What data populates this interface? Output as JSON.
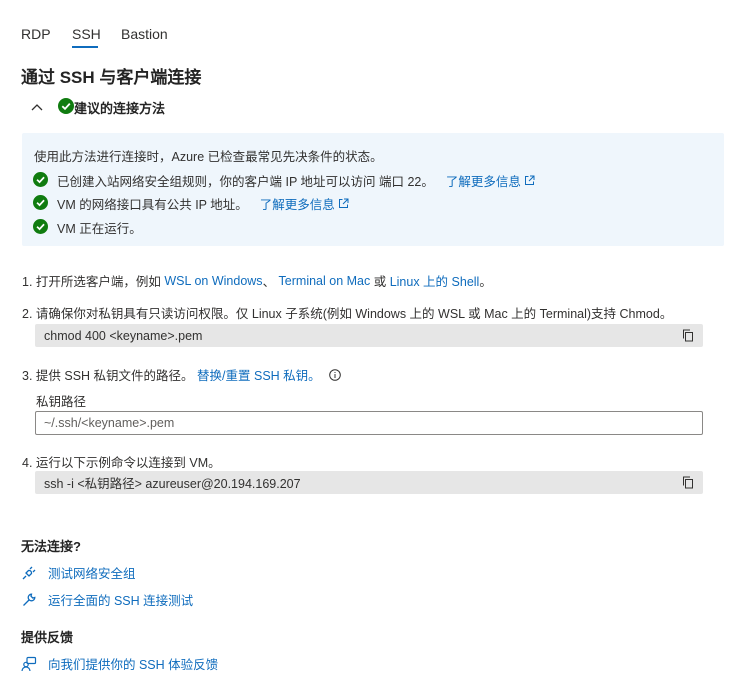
{
  "tabs": [
    {
      "label": "RDP"
    },
    {
      "label": "SSH"
    },
    {
      "label": "Bastion"
    }
  ],
  "page_title": "通过 SSH 与客户端连接",
  "expander": {
    "label": "建议的连接方法"
  },
  "infobox": {
    "intro": "使用此方法进行连接时，Azure 已检查最常见先决条件的状态。",
    "checks": [
      {
        "text": "已创建入站网络安全组规则，你的客户端 IP 地址可以访问 端口 22。",
        "link": "了解更多信息"
      },
      {
        "text": "VM 的网络接口具有公共 IP 地址。",
        "link": "了解更多信息"
      },
      {
        "text": "VM 正在运行。"
      }
    ]
  },
  "steps": {
    "step1": {
      "prefix": "1. 打开所选客户端，例如 ",
      "link1": "WSL on Windows",
      "sep1": "、 ",
      "link2": "Terminal on Mac",
      "sep2": " 或 ",
      "link3": "Linux 上的 Shell",
      "suffix": "。"
    },
    "step2": {
      "text": "2. 请确保你对私钥具有只读访问权限。仅 Linux 子系统(例如 Windows 上的 WSL 或 Mac 上的 Terminal)支持 Chmod。",
      "code": "chmod 400 <keyname>.pem"
    },
    "step3": {
      "prefix": "3. 提供 SSH 私钥文件的路径。 ",
      "link": "替换/重置 SSH 私钥。",
      "field_label": "私钥路径",
      "placeholder": "~/.ssh/<keyname>.pem"
    },
    "step4": {
      "text": "4. 运行以下示例命令以连接到 VM。",
      "code": "ssh -i <私钥路径> azureuser@20.194.169.207"
    }
  },
  "troubleshoot": {
    "heading": "无法连接?",
    "links": [
      "测试网络安全组",
      "运行全面的 SSH 连接测试"
    ]
  },
  "feedback": {
    "heading": "提供反馈",
    "link": "向我们提供你的 SSH 体验反馈"
  },
  "colors": {
    "accent": "#0f6cbd",
    "success": "#107c10",
    "info_bg": "#eff6fc",
    "code_bg": "#e6e6e6"
  }
}
